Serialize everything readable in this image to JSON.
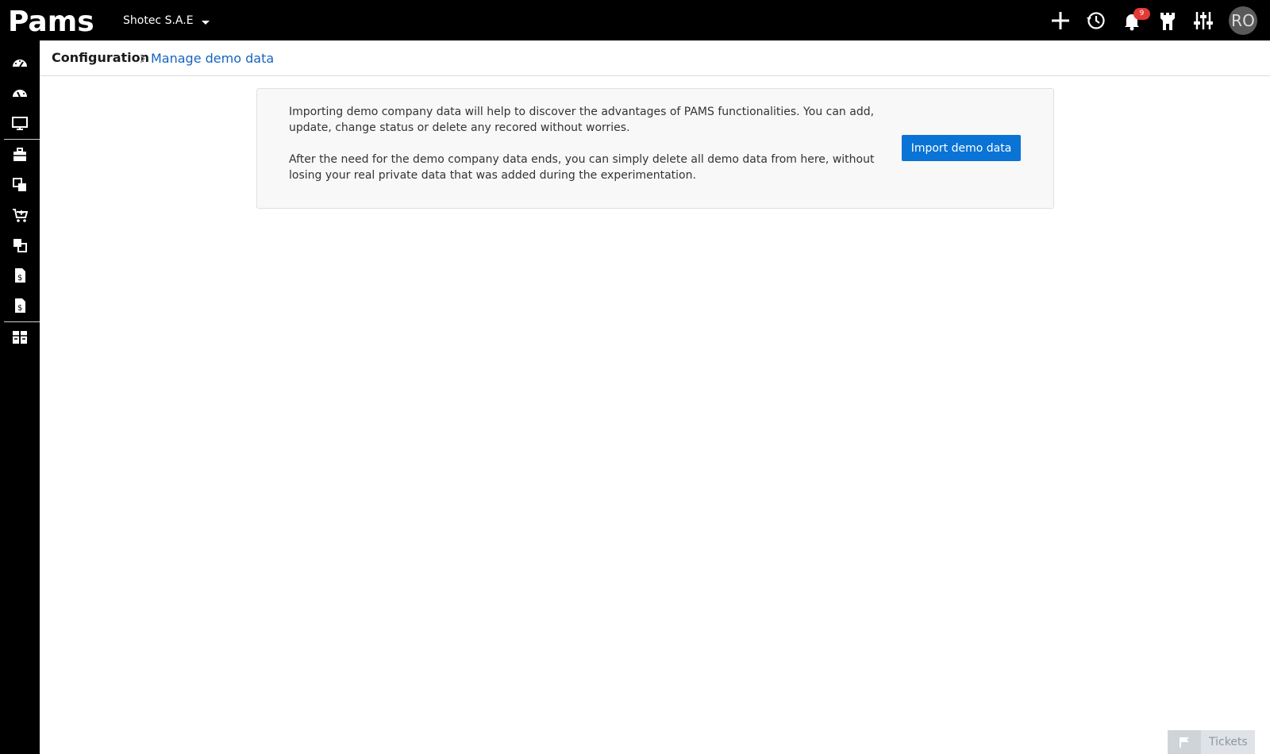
{
  "app": {
    "logo_text": "Pams",
    "company_name": "Shotec S.A.E",
    "notification_count": "9",
    "user_initials": "RO"
  },
  "topbar": {
    "icons": [
      "plus-icon",
      "history-icon",
      "bell-icon",
      "castle-icon",
      "sliders-icon"
    ]
  },
  "sidebar": {
    "items": [
      {
        "icon": "dashboard-icon"
      },
      {
        "icon": "dashboard-alt-icon"
      },
      {
        "icon": "monitor-icon"
      },
      {
        "icon": "briefcase-icon"
      },
      {
        "icon": "boxes-icon"
      },
      {
        "icon": "cart-icon"
      },
      {
        "icon": "boxes-out-icon"
      },
      {
        "icon": "invoice-icon"
      },
      {
        "icon": "invoice-alt-icon"
      },
      {
        "icon": "config-grid-icon"
      }
    ]
  },
  "breadcrumb": {
    "root": "Configuration",
    "current": "Manage demo data"
  },
  "panel": {
    "paragraph1": "Importing demo company data will help to discover the advantages of PAMS functionalities. You can add, update, change status or delete any recored without worries.",
    "paragraph2": "After the need for the demo company data ends, you can simply delete all demo data from here, without losing your real private data that was added during the experimentation.",
    "button_label": "Import demo data"
  },
  "tickets": {
    "label": "Tickets"
  },
  "colors": {
    "topbar_bg": "#000000",
    "accent_blue": "#0a73d6",
    "breadcrumb_link": "#1565c0",
    "badge_red": "#e53935"
  }
}
